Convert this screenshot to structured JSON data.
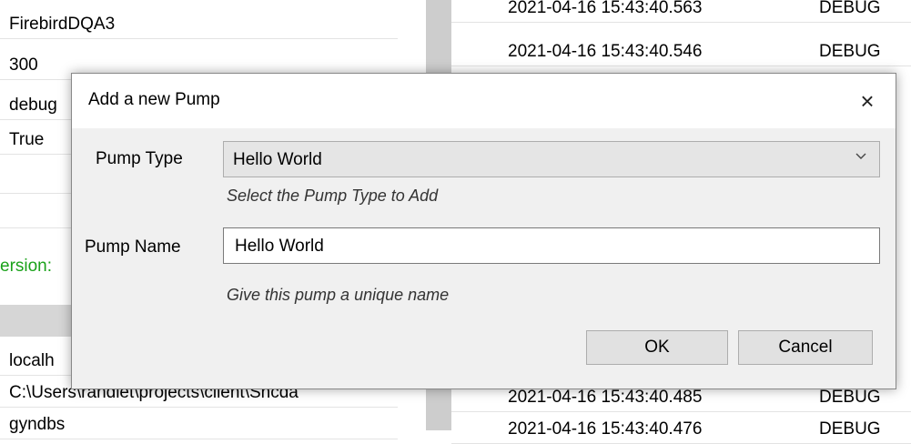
{
  "background": {
    "properties": [
      "FirebirdDQA3",
      "300",
      "debug",
      "True",
      "",
      ""
    ],
    "version_label": "ersion:",
    "connection_rows": [
      "localh",
      "C:\\Users\\randlet\\projects\\client\\Sncda",
      "gyndbs"
    ],
    "log_rows": [
      {
        "timestamp": "2021-04-16 15:43:40.563",
        "level": "DEBUG"
      },
      {
        "timestamp": "2021-04-16 15:43:40.546",
        "level": "DEBUG"
      },
      {
        "timestamp": "2021-04-16 15:43:40.485",
        "level": "DEBUG"
      },
      {
        "timestamp": "2021-04-16 15:43:40.476",
        "level": "DEBUG"
      }
    ]
  },
  "dialog": {
    "title": "Add a new Pump",
    "close_icon": "×",
    "pump_type_label": "Pump Type",
    "pump_type_value": "Hello World",
    "pump_type_hint": "Select the Pump Type to Add",
    "pump_name_label": "Pump Name",
    "pump_name_value": "Hello World",
    "pump_name_hint": "Give this pump  a unique name",
    "ok_label": "OK",
    "cancel_label": "Cancel",
    "dropdown_icon": "chevron-down-icon"
  }
}
